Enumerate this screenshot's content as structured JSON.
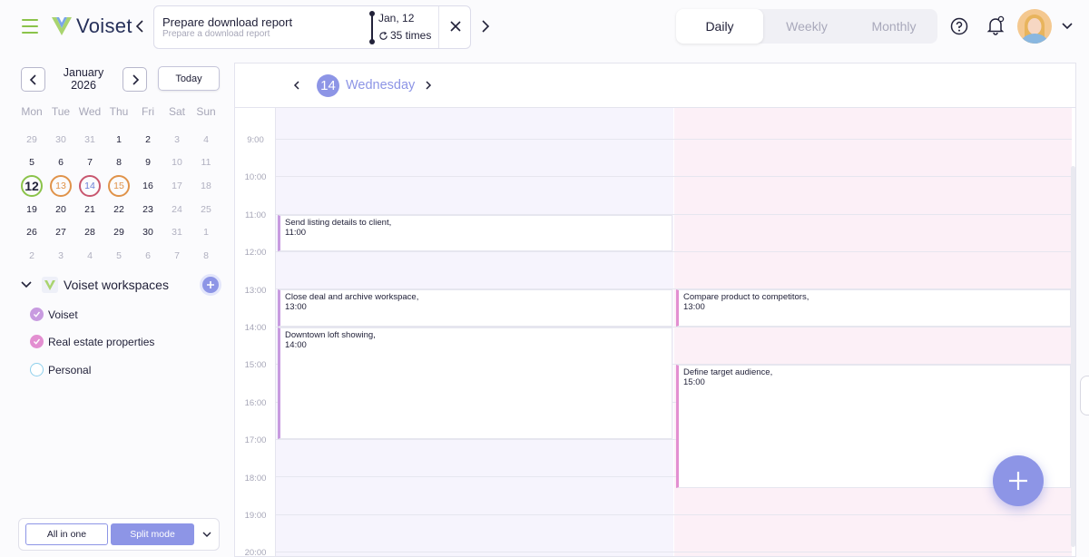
{
  "app": {
    "name": "Voiset"
  },
  "task": {
    "title": "Prepare download report",
    "subtitle": "Prepare a download report",
    "date": "Jan, 12",
    "repeat": "35 times"
  },
  "view_modes": [
    "Daily",
    "Weekly",
    "Monthly"
  ],
  "active_view": "Daily",
  "mini_calendar": {
    "month": "January",
    "year": "2026",
    "today_label": "Today",
    "weekdays": [
      "Mon",
      "Tue",
      "Wed",
      "Thu",
      "Fri",
      "Sat",
      "Sun"
    ],
    "weeks": [
      [
        "29",
        "30",
        "31",
        "1",
        "2",
        "3",
        "4"
      ],
      [
        "5",
        "6",
        "7",
        "8",
        "9",
        "10",
        "11"
      ],
      [
        "12",
        "13",
        "14",
        "15",
        "16",
        "17",
        "18"
      ],
      [
        "19",
        "20",
        "21",
        "22",
        "23",
        "24",
        "25"
      ],
      [
        "26",
        "27",
        "28",
        "29",
        "30",
        "31",
        "1"
      ],
      [
        "2",
        "3",
        "4",
        "5",
        "6",
        "7",
        "8"
      ]
    ]
  },
  "workspaces": {
    "title": "Voiset workspaces",
    "items": [
      {
        "label": "Voiset",
        "color": "#c89be0",
        "checked": true
      },
      {
        "label": "Real estate properties",
        "color": "#e38fd1",
        "checked": true
      },
      {
        "label": "Personal",
        "color": "#8fd0ec",
        "checked": false
      }
    ]
  },
  "modes": {
    "all_in_one": "All in one",
    "split": "Split mode"
  },
  "day_view": {
    "day_number": "14",
    "day_name": "Wednesday",
    "hours": [
      "9:00",
      "10:00",
      "11:00",
      "12:00",
      "13:00",
      "14:00",
      "15:00",
      "16:00",
      "17:00",
      "18:00",
      "19:00",
      "20:00"
    ],
    "events": [
      {
        "title": "Send listing details to client,",
        "time": "11:00",
        "column": "a"
      },
      {
        "title": "Close deal and archive workspace,",
        "time": "13:00",
        "column": "a"
      },
      {
        "title": "Downtown loft showing,",
        "time": "14:00",
        "column": "a"
      },
      {
        "title": "Compare product to competitors,",
        "time": "13:00",
        "column": "b"
      },
      {
        "title": "Define target audience,",
        "time": "15:00",
        "column": "b"
      }
    ]
  },
  "colors": {
    "accent": "#8d95e6",
    "brand_green": "#8bc34a",
    "column_a_bg": "#f6f4fd",
    "column_b_bg": "#fcf0f7",
    "event_a_border": "#c89be0",
    "event_b_border": "#e38fd1"
  }
}
